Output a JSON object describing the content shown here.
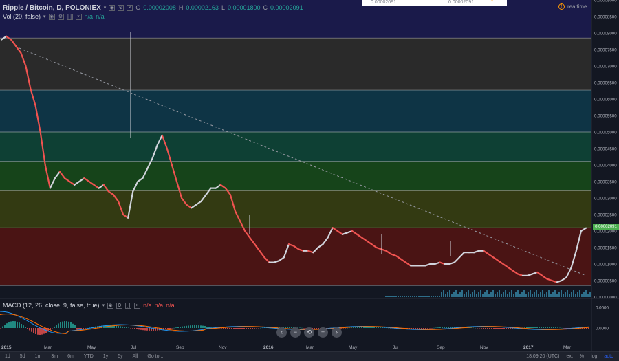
{
  "header": {
    "symbol": "Ripple / Bitcoin, D, POLONIEX",
    "o_label": "O",
    "o_value": "0.00002008",
    "h_label": "H",
    "h_value": "0.00002163",
    "l_label": "L",
    "l_value": "0.00001800",
    "c_label": "C",
    "c_value": "0.00002091",
    "vol_label": "Vol (20, false)",
    "vol_na1": "n/a",
    "vol_na2": "n/a",
    "realtime": "realtime",
    "topbox_left": "0.00002091",
    "topbox_right": "0.00002091"
  },
  "macd": {
    "label": "MACD (12, 26, close, 9, false, true)",
    "na1": "n/a",
    "na2": "n/a",
    "na3": "n/a",
    "axis": [
      "0.0000",
      "0.0000"
    ]
  },
  "price_tag": "0.00002091",
  "nav_buttons": [
    "‹",
    "−",
    "⟲",
    "+",
    "›"
  ],
  "timeframes": [
    "1d",
    "5d",
    "1m",
    "3m",
    "6m",
    "YTD",
    "1y",
    "5y",
    "All",
    "Go to..."
  ],
  "bottom_right": {
    "time": "18:09:20 (UTC)",
    "ext": "ext",
    "pct": "%",
    "log": "log",
    "auto": "auto"
  },
  "colors": {
    "background": "#131722",
    "up": "#d1d4dc",
    "down": "#ef5350",
    "trendline": "#9598a1",
    "bands": [
      "#1a1a4a",
      "#2a2a2a",
      "#0e3445",
      "#0e4034",
      "#16441a",
      "#333a12",
      "#4a1414"
    ]
  },
  "chart_data": [
    {
      "type": "line",
      "title": "Ripple / Bitcoin, D, POLONIEX",
      "x_ticks": [
        "2015",
        "Mar",
        "May",
        "Jul",
        "Sep",
        "Nov",
        "2016",
        "Mar",
        "May",
        "Jul",
        "Sep",
        "Nov",
        "2017",
        "Mar"
      ],
      "y_ticks": [
        "0.00009000",
        "0.00008500",
        "0.00008000",
        "0.00007500",
        "0.00007000",
        "0.00006500",
        "0.00006000",
        "0.00005500",
        "0.00005000",
        "0.00004500",
        "0.00004000",
        "0.00003500",
        "0.00003000",
        "0.00002500",
        "0.00002000",
        "0.00001500",
        "0.00001000",
        "0.00000500",
        "0.00000000"
      ],
      "ylim": [
        0,
        9e-05
      ],
      "fib_levels": [
        7.85e-05,
        6.27e-05,
        5e-05,
        4.11e-05,
        3.22e-05,
        2.1e-05,
        3.5e-06
      ],
      "series": [
        {
          "values": [
            7.8,
            7.9,
            7.8,
            7.6,
            7.4,
            7.0,
            6.3,
            5.8,
            5.0,
            4.0,
            3.3,
            3.6,
            3.8,
            3.6,
            3.5,
            3.4,
            3.5,
            3.6,
            3.5,
            3.4,
            3.3,
            3.4,
            3.2,
            3.1,
            2.9,
            2.5,
            2.4,
            3.2,
            3.5,
            3.6,
            3.9,
            4.2,
            4.6,
            4.9,
            4.5,
            4.0,
            3.5,
            3.0,
            2.8,
            2.7,
            2.8,
            2.9,
            3.1,
            3.3,
            3.3,
            3.4,
            3.3,
            3.1,
            2.6,
            2.3,
            2.0,
            1.8,
            1.6,
            1.4,
            1.2,
            1.05,
            1.05,
            1.1,
            1.2,
            1.6,
            1.55,
            1.45,
            1.4,
            1.4,
            1.35,
            1.5,
            1.6,
            1.8,
            2.1,
            2.0,
            1.9,
            1.95,
            2.0,
            1.9,
            1.8,
            1.7,
            1.6,
            1.5,
            1.45,
            1.4,
            1.3,
            1.25,
            1.15,
            1.05,
            0.95,
            0.95,
            0.95,
            0.95,
            1.0,
            1.0,
            1.05,
            1.0,
            1.0,
            1.05,
            1.2,
            1.35,
            1.35,
            1.35,
            1.4,
            1.4,
            1.3,
            1.2,
            1.1,
            1.0,
            0.9,
            0.8,
            0.7,
            0.65,
            0.65,
            0.7,
            0.75,
            0.65,
            0.55,
            0.5,
            0.45,
            0.5,
            0.6,
            0.9,
            1.4,
            2.0,
            2.09
          ]
        }
      ]
    },
    {
      "type": "line",
      "title": "MACD (12, 26, close, 9, false, true)"
    }
  ]
}
